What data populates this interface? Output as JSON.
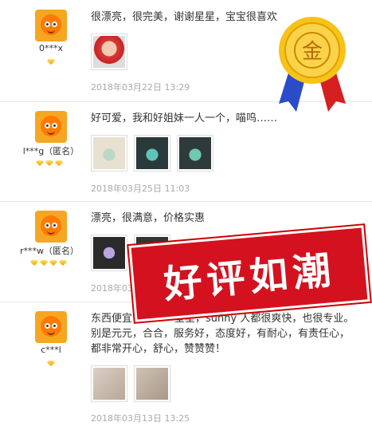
{
  "reviews": [
    {
      "user": "0***x",
      "level_diamonds": 1,
      "text": "很漂亮，很完美，谢谢星星，宝宝很喜欢",
      "photos": [
        "baby-photo"
      ],
      "date": "2018年03月22日 13:29"
    },
    {
      "user": "l***g（匿名）",
      "level_diamonds": 3,
      "text": "好可爱，我和好姐妹一人一个，喵呜……",
      "photos": [
        "jade-pendant-1",
        "jade-pendant-2",
        "jade-pendant-3"
      ],
      "date": "2018年03月25日 11:03"
    },
    {
      "user": "r***w（匿名）",
      "level_diamonds": 4,
      "text": "漂亮，很满意，价格实惠",
      "photos": [
        "bead-1",
        "bead-2"
      ],
      "date": "2018年03月2"
    },
    {
      "user": "c***l",
      "level_diamonds": 1,
      "text_line1": "东西便宜，",
      "text_line1b": "星星，sunny 人都很爽快，也很专业。",
      "text_line2": "别是元元，合合，服务好，态度好，有耐心，有责任心，",
      "text_line3": "都非常开心，舒心，赞赞赞！",
      "photos": [
        "hand-jade-1",
        "hand-jade-2"
      ],
      "date": "2018年03月13日 13:25"
    }
  ],
  "medal_text": "金",
  "banner_text": "好评如潮",
  "colors": {
    "accent": "#f5a623",
    "banner": "#d4121f",
    "date": "#aaaaaa"
  }
}
